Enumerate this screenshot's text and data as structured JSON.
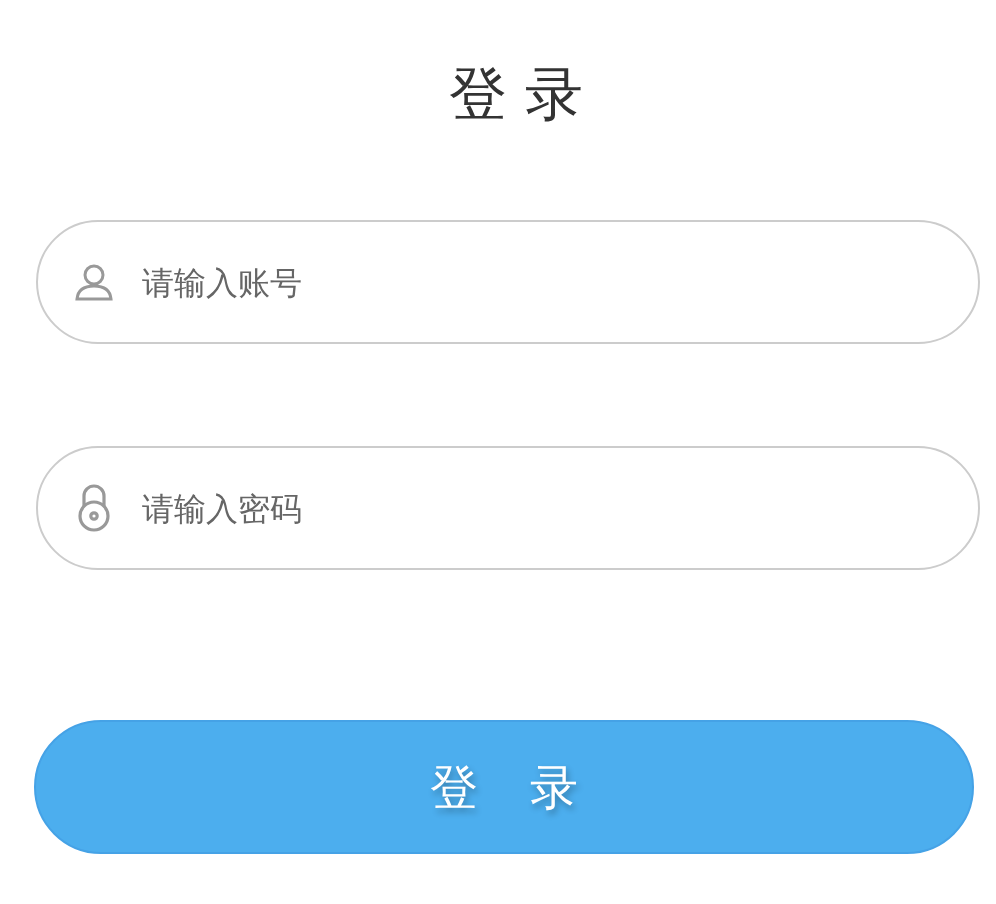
{
  "title": "登 录",
  "fields": [
    {
      "kind": "user",
      "placeholder": "请输入账号"
    },
    {
      "kind": "lock",
      "placeholder": "请输入密码"
    }
  ],
  "button": "登 录"
}
